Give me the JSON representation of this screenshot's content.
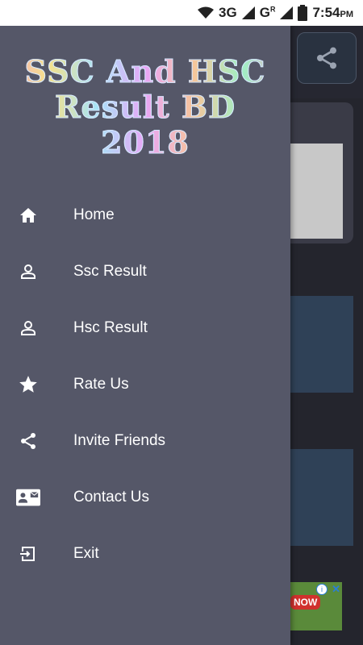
{
  "status_bar": {
    "network": "3G",
    "network2": "G",
    "network2_sup": "R",
    "time": "7:54",
    "ampm": "PM"
  },
  "drawer": {
    "title_lines": [
      "SSC And HSC",
      "Result BD",
      "2018"
    ],
    "items": [
      {
        "label": "Home",
        "icon": "home-icon"
      },
      {
        "label": "Ssc Result",
        "icon": "person-icon"
      },
      {
        "label": "Hsc Result",
        "icon": "person-icon"
      },
      {
        "label": "Rate Us",
        "icon": "star-icon"
      },
      {
        "label": "Invite Friends",
        "icon": "share-icon"
      },
      {
        "label": "Contact Us",
        "icon": "contact-card-icon"
      },
      {
        "label": "Exit",
        "icon": "exit-icon"
      }
    ]
  },
  "ad": {
    "badge": "NOW",
    "info": "i",
    "close": "✕"
  },
  "colors": {
    "drawer_bg": "#555768",
    "app_bg": "#24252d",
    "card_blue": "#2f4157"
  }
}
